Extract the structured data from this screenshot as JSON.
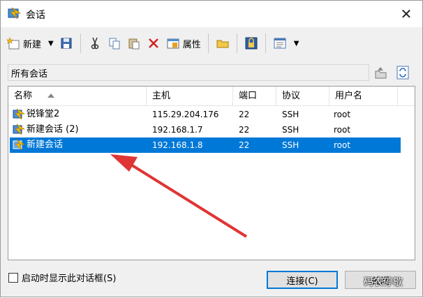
{
  "window": {
    "title": "会话",
    "close_glyph": "✕"
  },
  "toolbar": {
    "new_label": "新建",
    "properties_label": "属性"
  },
  "path": {
    "current": "所有会话"
  },
  "table": {
    "columns": [
      "名称",
      "主机",
      "端口",
      "协议",
      "用户名"
    ],
    "rows": [
      {
        "name": "锐锋堂2",
        "host": "115.29.204.176",
        "port": "22",
        "protocol": "SSH",
        "user": "root",
        "selected": false
      },
      {
        "name": "新建会话 (2)",
        "host": "192.168.1.7",
        "port": "22",
        "protocol": "SSH",
        "user": "root",
        "selected": false
      },
      {
        "name": "新建会话",
        "host": "192.168.1.8",
        "port": "22",
        "protocol": "SSH",
        "user": "root",
        "selected": true
      }
    ]
  },
  "footer": {
    "startup_checkbox_label": "启动时显示此对话框(S)",
    "connect_label": "连接(C)",
    "close_label": "关闭"
  },
  "watermark": {
    "text": "码农停歇"
  },
  "colors": {
    "selection": "#0078d7",
    "annotation_arrow": "#e03535",
    "dialog_bg": "#f0f0f0"
  },
  "icons": [
    "session-icon",
    "new-session-icon",
    "save-icon",
    "cut-icon",
    "copy-icon",
    "paste-icon",
    "delete-icon",
    "properties-icon",
    "folder-icon",
    "lock-icon",
    "view-icon",
    "close-icon"
  ]
}
